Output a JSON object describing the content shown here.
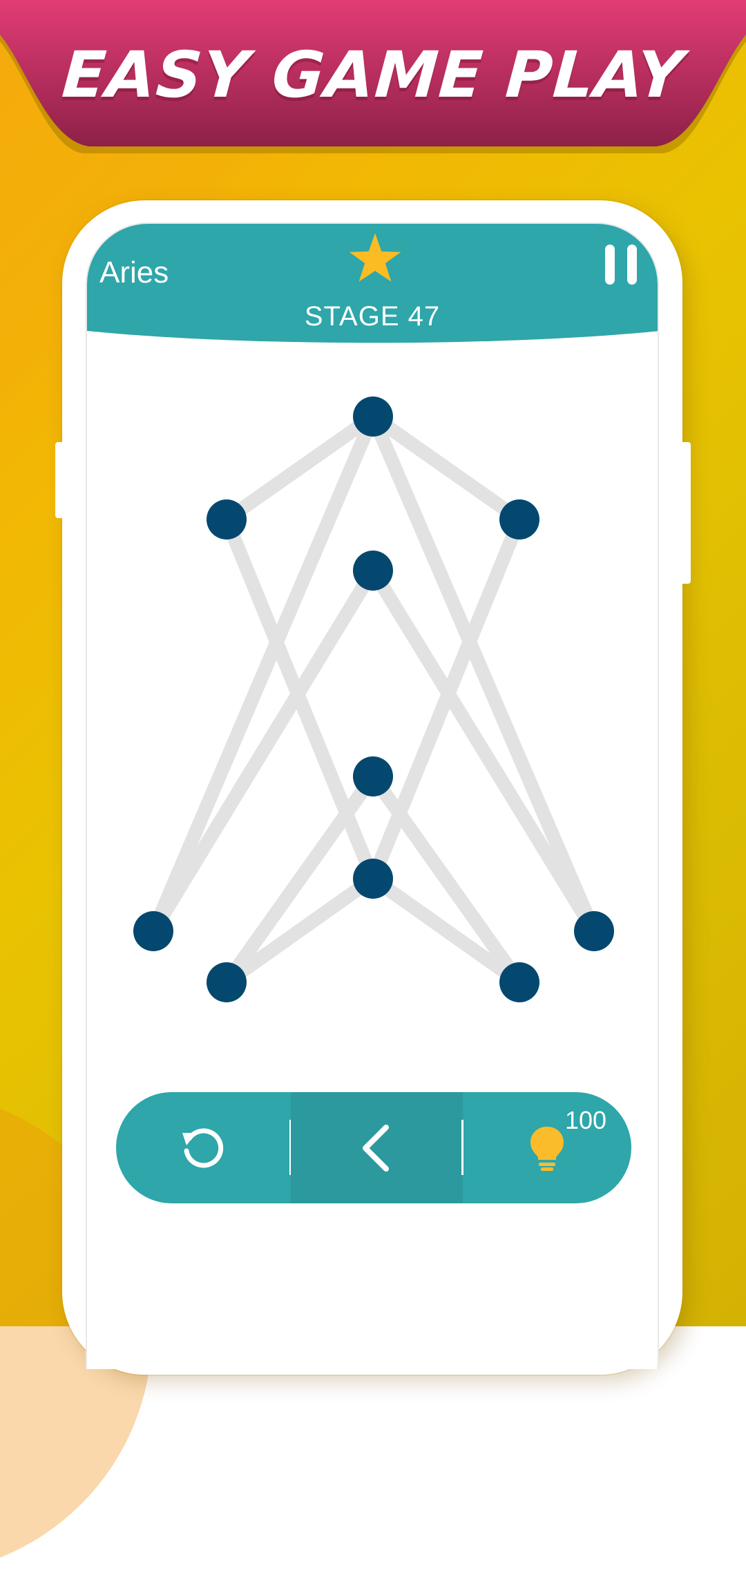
{
  "banner": {
    "title": "EASY GAME PLAY",
    "color_top": "#e23c75",
    "color_bottom": "#8e2148"
  },
  "game": {
    "level_name": "Aries",
    "stage_label": "STAGE 47",
    "header_color": "#2ea6aa",
    "star_color": "#fbbc23",
    "dot_color": "#05486f",
    "line_color": "#e2e2e2"
  },
  "toolbar": {
    "hint_count": "100",
    "bulb_color": "#fbbc2b",
    "icons": [
      "restart-icon",
      "back-arrow-icon",
      "lightbulb-icon"
    ]
  }
}
